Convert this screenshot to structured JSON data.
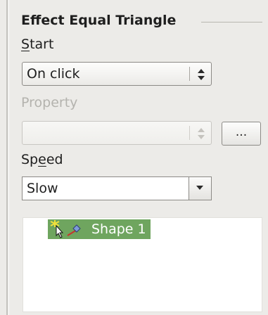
{
  "panel": {
    "title": "Effect Equal Triangle",
    "start": {
      "label_underlined": "S",
      "label_rest": "tart",
      "value": "On click"
    },
    "property": {
      "label": "Property",
      "value": "",
      "button_label": "..."
    },
    "speed": {
      "label_before": "Sp",
      "label_underlined": "e",
      "label_after": "ed",
      "value": "Slow"
    },
    "shape_list": [
      {
        "icons": [
          "effect-sparkle-icon",
          "mouse-pointer-icon",
          "shape-diamond-icon"
        ],
        "label": "Shape 1"
      }
    ]
  },
  "colors": {
    "background": "#ecebe8",
    "list_selection": "#6fa55f",
    "disabled_text": "#b4b3ae"
  }
}
